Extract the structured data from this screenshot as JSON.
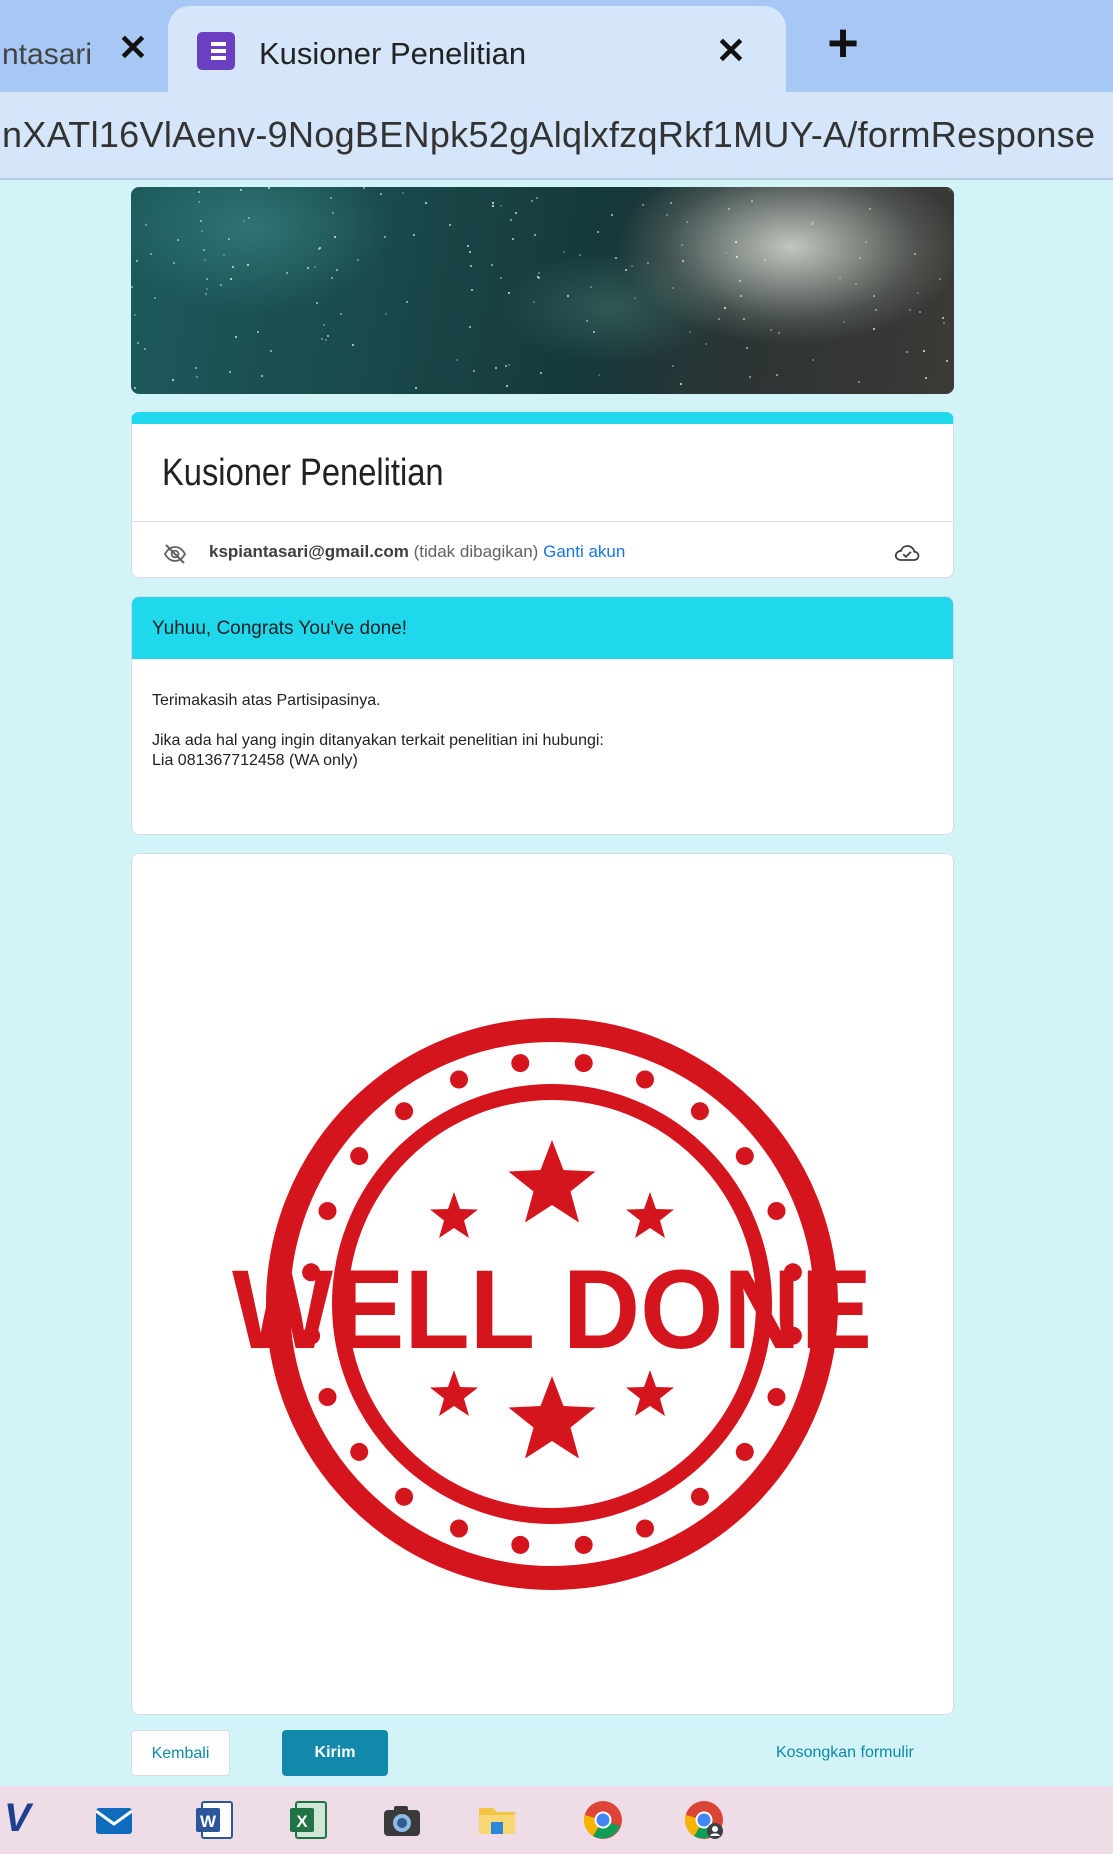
{
  "browser": {
    "tabs": [
      {
        "title": "ntasari",
        "active": false
      },
      {
        "title": "Kusioner Penelitian",
        "active": true
      }
    ],
    "tab_close_glyph": "✕",
    "new_tab_glyph": "+",
    "address": "nXATl16VlAenv-9NogBENpk52gAlqlxfzqRkf1MUY-A/formResponse"
  },
  "form": {
    "title": "Kusioner Penelitian",
    "account": {
      "email": "kspiantasari@gmail.com",
      "visibility_note": "(tidak dibagikan)",
      "switch_account_label": "Ganti akun"
    },
    "section": {
      "title": "Yuhuu, Congrats You've done!",
      "lines": [
        "Terimakasih atas Partisipasinya.",
        "Jika ada hal yang ingin ditanyakan terkait penelitian ini hubungi:",
        "Lia 081367712458 (WA only)"
      ]
    },
    "image": {
      "stamp_text": "WELL DONE",
      "stamp_color": "#d4151d"
    },
    "buttons": {
      "back": "Kembali",
      "submit": "Kirim",
      "clear": "Kosongkan formulir"
    }
  },
  "colors": {
    "theme_accent": "#1fd8ec",
    "page_background": "#d2f4f8",
    "submit_button": "#1289aa",
    "link": "#1a73e8"
  },
  "taskbar": {
    "apps": [
      "visual-studio-icon",
      "mail-icon",
      "word-icon",
      "excel-icon",
      "camera-icon",
      "file-explorer-icon",
      "chrome-icon",
      "chrome-profile-icon"
    ]
  }
}
